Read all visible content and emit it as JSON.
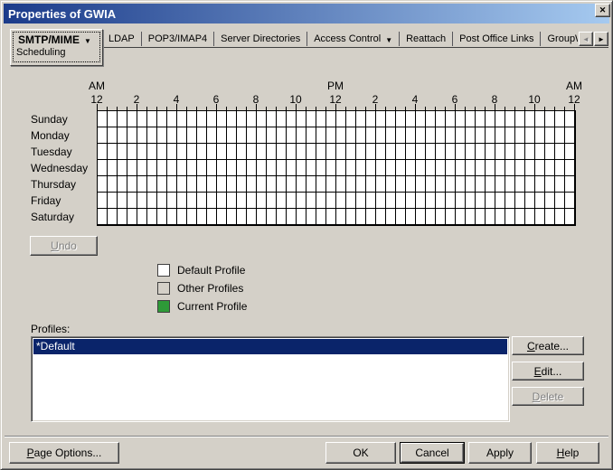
{
  "window": {
    "title": "Properties of GWIA",
    "close_icon": "✕"
  },
  "tabs": {
    "dropdown_glyph": "▼",
    "active": {
      "label": "SMTP/MIME",
      "sub_label": "Scheduling"
    },
    "items": [
      {
        "label": "LDAP"
      },
      {
        "label": "POP3/IMAP4"
      },
      {
        "label": "Server Directories"
      },
      {
        "label": "Access Control",
        "dropdown": true
      },
      {
        "label": "Reattach"
      },
      {
        "label": "Post Office Links"
      },
      {
        "label": "GroupW"
      }
    ],
    "scroll_left_icon": "◄",
    "scroll_right_icon": "►"
  },
  "schedule": {
    "meridiem": {
      "left": "AM",
      "middle": "PM",
      "right": "AM"
    },
    "time_labels": [
      "12",
      "2",
      "4",
      "6",
      "8",
      "10",
      "12",
      "2",
      "4",
      "6",
      "8",
      "10",
      "12"
    ],
    "days": [
      "Sunday",
      "Monday",
      "Tuesday",
      "Wednesday",
      "Thursday",
      "Friday",
      "Saturday"
    ],
    "columns": 48,
    "rows": 7,
    "undo": {
      "mn": "U",
      "rest": "ndo"
    }
  },
  "legend": {
    "items": [
      {
        "label": "Default Profile",
        "color": "#ffffff"
      },
      {
        "label": "Other Profiles",
        "color": "#d4d0c8"
      },
      {
        "label": "Current Profile",
        "color": "#2e9a38"
      }
    ]
  },
  "profiles": {
    "label": "Profiles:",
    "items": [
      {
        "name": "*Default",
        "selected": true
      }
    ],
    "create": {
      "mn": "C",
      "rest": "reate..."
    },
    "edit": {
      "mn": "E",
      "rest": "dit..."
    },
    "delete": {
      "mn": "D",
      "rest": "elete"
    }
  },
  "footer": {
    "page_options": {
      "mn": "P",
      "rest": "age Options..."
    },
    "ok": "OK",
    "cancel": "Cancel",
    "apply": "Apply",
    "help": {
      "mn": "H",
      "rest": "elp"
    }
  },
  "colors": {
    "dialog_bg": "#d4d0c8",
    "titlebar_start": "#1b3b8a",
    "titlebar_end": "#a6caf0",
    "selection_bg": "#0a246a",
    "grid_cell": "#ffffff",
    "current_profile_green": "#2e9a38"
  }
}
